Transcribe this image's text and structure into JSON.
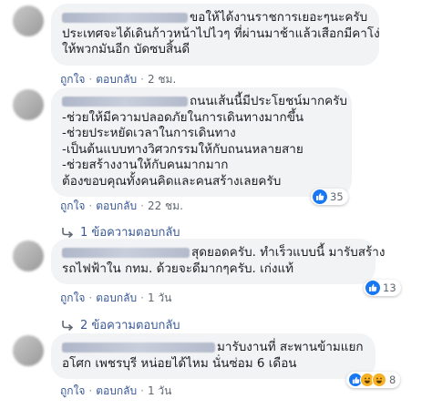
{
  "comments": [
    {
      "lines": [
        "ขอให้ได้งานราชการเยอะๆนะครับ",
        "ประเทศจะได้เดินก้าวหน้าไปไวๆ ที่ผ่านมาช้าแล้วเสือกมีคาโง่",
        "ให้พวกมันอีก บัดซบสิ้นดี"
      ],
      "like": "ถูกใจ",
      "reply": "ตอบกลับ",
      "time": "2 ชม."
    },
    {
      "lines": [
        "ถนนเส้นนี้มีประโยชน์มากครับ",
        "-ช่วยให้มีความปลอดภัยในการเดินทางมากขึ้น",
        "-ช่วยประหยัดเวลาในการเดินทาง",
        "-เป็นต้นแบบทางวิศวกรรมให้กับถนนหลายสาย",
        "-ช่วยสร้างงานให้กับคนมากมาก",
        "ต้องขอบคุณทั้งคนคิดและคนสร้างเลยครับ"
      ],
      "like": "ถูกใจ",
      "reply": "ตอบกลับ",
      "time": "22 ชม.",
      "reaction_count": "35",
      "replies_label": "1 ข้อความตอบกลับ"
    },
    {
      "lines": [
        "สุดยอดครับ. ทำเร็วแบบนี้ มารับสร้าง",
        "รถไฟฟ้าใน กทม. ด้วยจะดีมากๆครับ. เก่งแท้"
      ],
      "like": "ถูกใจ",
      "reply": "ตอบกลับ",
      "time": "1 วัน",
      "reaction_count": "13",
      "replies_label": "2 ข้อความตอบกลับ"
    },
    {
      "lines": [
        "มารับงานที่ สะพานข้ามแยก",
        "อโศก เพชรบุรี หน่อยได้ไหม นั่นซ่อม 6 เดือน"
      ],
      "like": "ถูกใจ",
      "reply": "ตอบกลับ",
      "time": "1 วัน",
      "reaction_count": "8"
    }
  ],
  "colors": {
    "bubble": "#f2f3f5",
    "link": "#385898",
    "meta": "#616770",
    "like_blue": "#1877f2",
    "haha_yellow": "#f7b125"
  },
  "icons": [
    "avatar-blurred",
    "like-icon",
    "haha-icon",
    "reply-arrow-icon"
  ]
}
